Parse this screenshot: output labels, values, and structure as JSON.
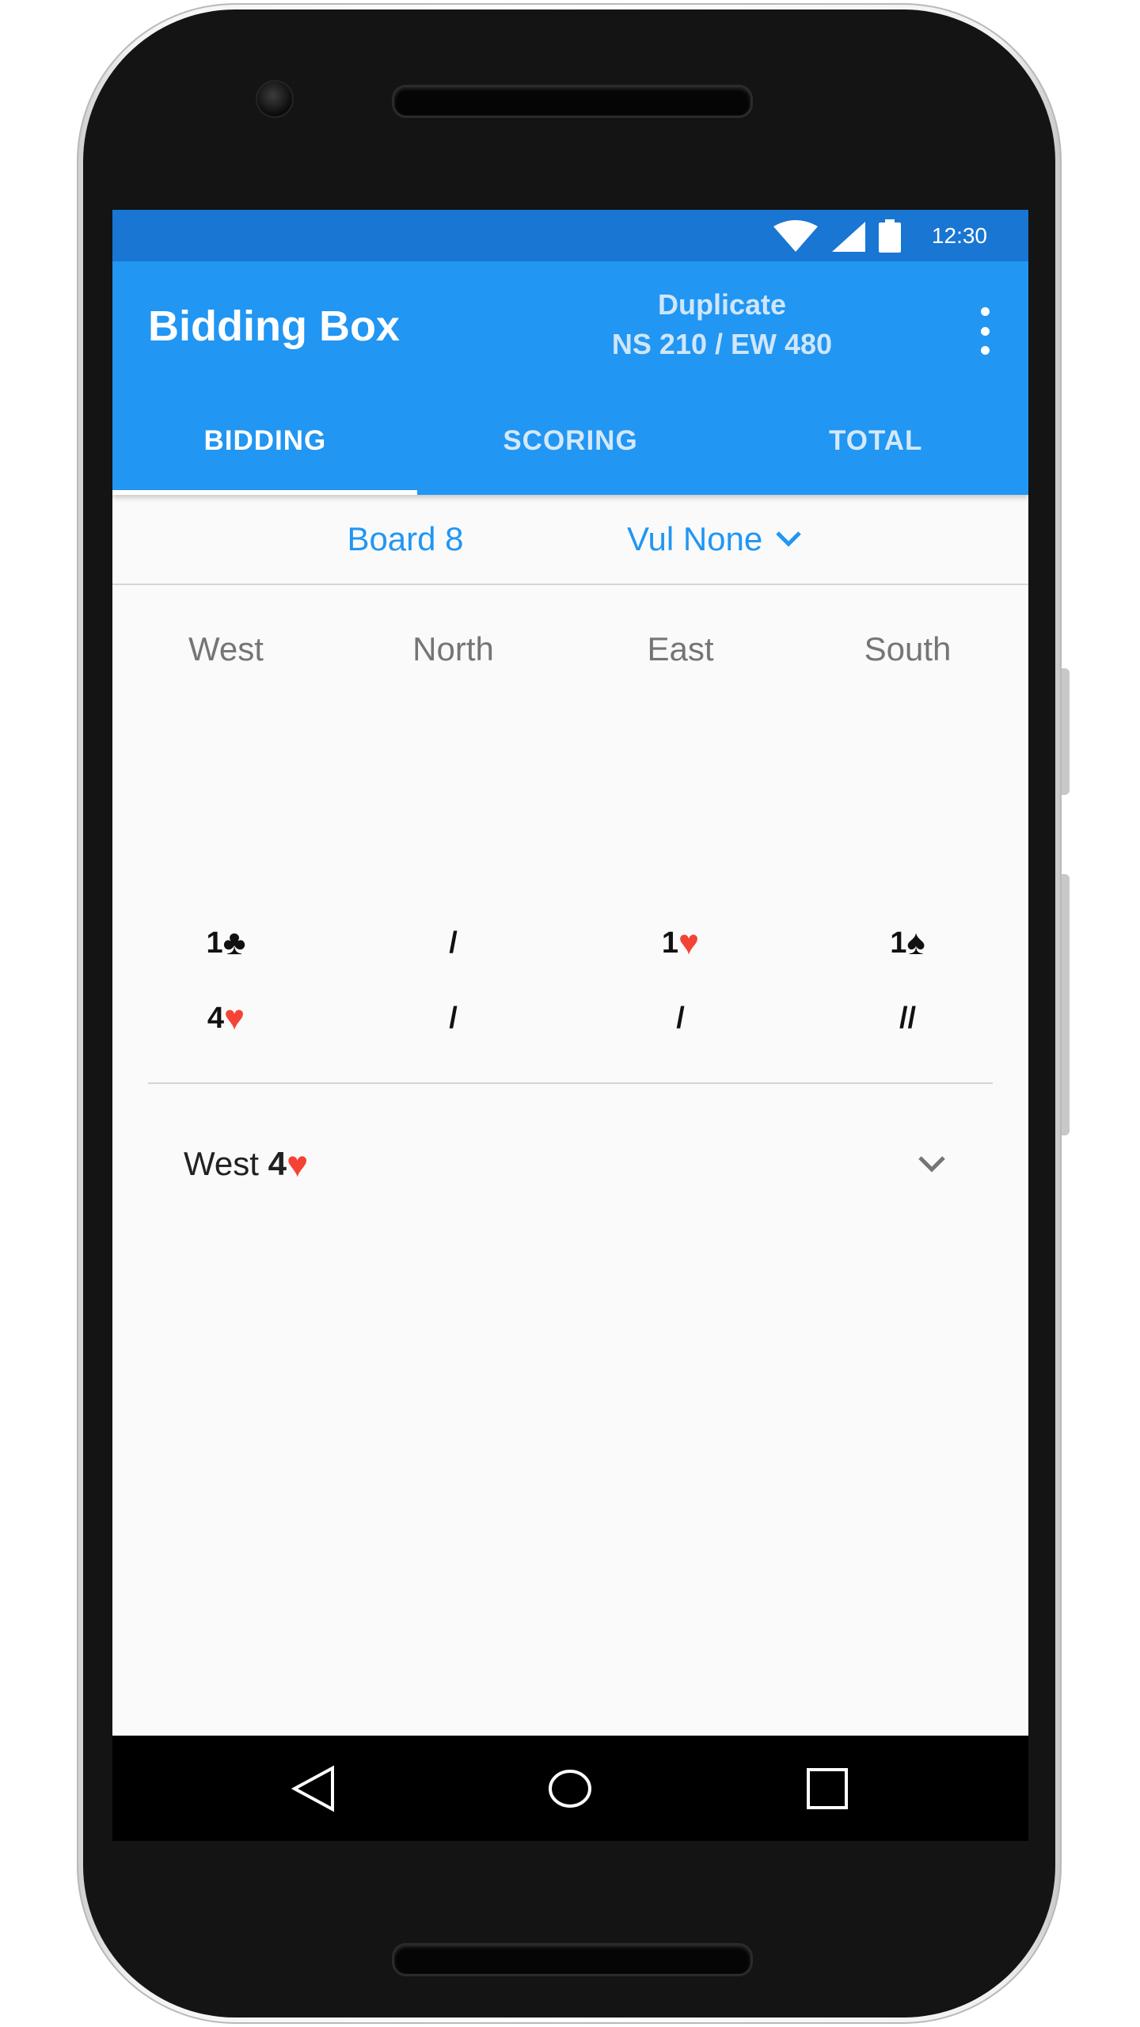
{
  "status_bar": {
    "time": "12:30",
    "icons": [
      "wifi-icon",
      "cell-signal-icon",
      "battery-icon"
    ]
  },
  "app_bar": {
    "title": "Bidding Box",
    "mode_label": "Duplicate",
    "score_summary": "NS 210 / EW 480",
    "menu_icon": "more-vert-icon"
  },
  "tabs": [
    {
      "label": "BIDDING",
      "active": true
    },
    {
      "label": "SCORING",
      "active": false
    },
    {
      "label": "TOTAL",
      "active": false
    }
  ],
  "board": {
    "label": "Board 8",
    "vulnerability": "Vul None",
    "dropdown_icon": "chevron-down-icon"
  },
  "bidding": {
    "seats": [
      "West",
      "North",
      "East",
      "South"
    ],
    "rows": [
      [
        {
          "text": "1",
          "suit": "♣",
          "suit_color": "black"
        },
        {
          "text": "/",
          "suit": "",
          "suit_color": ""
        },
        {
          "text": "1",
          "suit": "♥",
          "suit_color": "red"
        },
        {
          "text": "1",
          "suit": "♠",
          "suit_color": "black"
        }
      ],
      [
        {
          "text": "4",
          "suit": "♥",
          "suit_color": "red"
        },
        {
          "text": "/",
          "suit": "",
          "suit_color": ""
        },
        {
          "text": "/",
          "suit": "",
          "suit_color": ""
        },
        {
          "text": "//",
          "suit": "",
          "suit_color": ""
        }
      ]
    ]
  },
  "contract": {
    "declarer": "West",
    "level": "4",
    "suit": "♥",
    "expand_icon": "chevron-down-icon"
  },
  "nav_bar": {
    "icons": [
      "back-icon",
      "home-icon",
      "recents-icon"
    ]
  },
  "colors": {
    "primary": "#2196f3",
    "primary_dark": "#1976d2",
    "red_suit": "#f44336",
    "background": "#fafafa"
  }
}
